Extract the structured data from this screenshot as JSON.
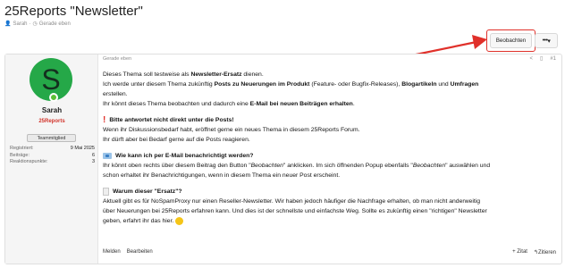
{
  "page": {
    "title": "25Reports \"Newsletter\"",
    "author": "Sarah",
    "separator": "·",
    "time": "Gerade eben"
  },
  "actions": {
    "watch_label": "Beobachten",
    "more_label": "•••",
    "more_chevron": "▾"
  },
  "accent_color": "#e0302a",
  "user": {
    "avatar_letter": "S",
    "name": "Sarah",
    "title": "25Reports",
    "banner": "Teammitglied",
    "stats": [
      {
        "label": "Registriert:",
        "value": "9 Mai 2025"
      },
      {
        "label": "Beiträge:",
        "value": "6"
      },
      {
        "label": "Reaktionspunkte:",
        "value": "3"
      }
    ]
  },
  "post": {
    "date": "Gerade eben",
    "number": "#1",
    "intro": {
      "l1_a": "Dieses Thema soll testweise als ",
      "l1_b": "Newsletter-Ersatz",
      "l1_c": " dienen.",
      "l2_a": "Ich werde unter diesem Thema zukünftig ",
      "l2_b": "Posts zu Neuerungen im Produkt",
      "l2_c": " (Feature- oder Bugfix-Releases), ",
      "l2_d": "Blogartikeln",
      "l2_e": " und ",
      "l2_f": "Umfragen",
      "l2_g": " erstellen.",
      "l3_a": "Ihr könnt dieses Thema beobachten und dadurch eine ",
      "l3_b": "E-Mail bei neuen Beiträgen erhalten",
      "l3_c": "."
    },
    "s1": {
      "icon": "!",
      "title": "Bitte antwortet nicht direkt unter die Posts!",
      "l1": "Wenn ihr Diskussionsbedarf habt, eröffnet gerne ein neues Thema in diesem 25Reports Forum.",
      "l2": "Ihr dürft aber bei Bedarf gerne auf die Posts reagieren."
    },
    "s2": {
      "title": "Wie kann ich per E-Mail benachrichtigt werden?",
      "l1_a": "Ihr könnt oben rechts über diesem Beitrag den Button \"",
      "l1_b": "Beobachten",
      "l1_c": "\" anklicken. Im sich öffnenden Popup ebenfalls \"",
      "l1_d": "Beobachten",
      "l1_e": "\" auswählen und",
      "l2": "schon erhaltet ihr Benachrichtigungen, wenn in diesem Thema ein neuer Post erscheint."
    },
    "s3": {
      "title": "Warum dieser \"Ersatz\"?",
      "l1": "Aktuell gibt es für NoSpamProxy nur einen Reseller-Newsletter. Wir haben jedoch häufiger die Nachfrage erhalten, ob man nicht anderweitig",
      "l2": "über Neuerungen bei 25Reports erfahren kann. Und dies ist der schnellste und einfachste Weg. Sollte es zukünftig einen \"richtigen\" Newsletter",
      "l3": "geben, erfahrt ihr das hier."
    },
    "footer": {
      "report": "Melden",
      "edit": "Bearbeiten",
      "quote_add": "+ Zitat",
      "reply": "Zitieren",
      "reply_icon": "↰"
    }
  }
}
